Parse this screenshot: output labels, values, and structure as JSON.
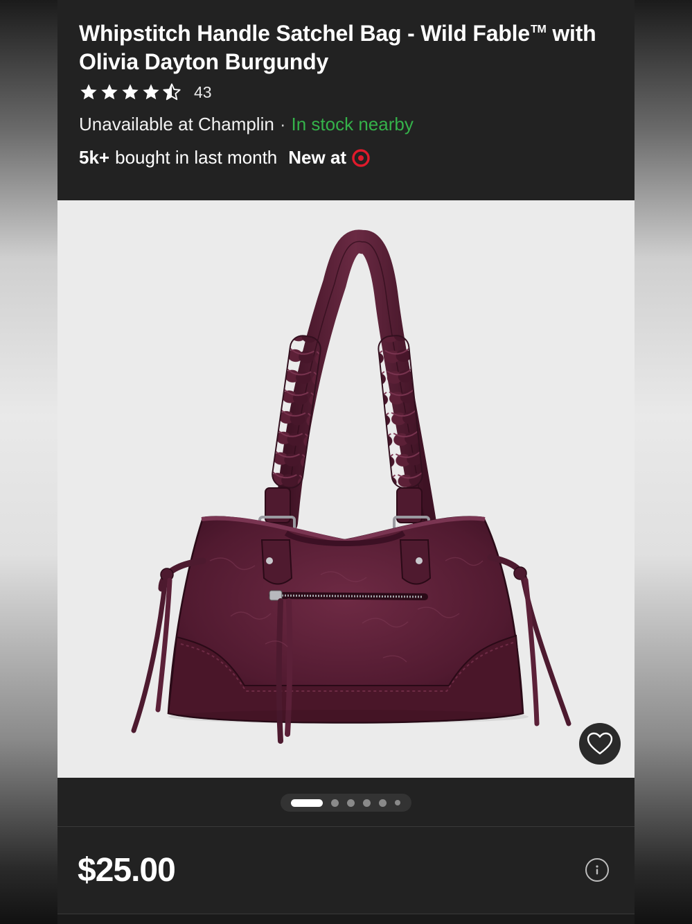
{
  "product": {
    "title": "Whipstitch Handle Satchel Bag - Wild Fable",
    "trademark": "TM",
    "title_line2": "with Olivia Dayton Burgundy",
    "rating": {
      "stars": 4.5,
      "count": "43"
    },
    "availability": {
      "store_text": "Unavailable at Champlin",
      "separator": "·",
      "nearby_text": "In stock nearby"
    },
    "social_proof": {
      "count": "5k+",
      "text": "bought in last month",
      "new_at": "New at"
    },
    "price": "$25.00"
  },
  "carousel": {
    "total": 6,
    "active_index": 0
  },
  "icons": {
    "favorite": "heart-icon",
    "info": "info-icon",
    "brand": "target-bullseye-icon",
    "rating": "star-icon"
  },
  "colors": {
    "background": "#222222",
    "in_stock": "#35b24a",
    "brand_red": "#e01a2b",
    "bag_burgundy": "#5e1f38"
  }
}
